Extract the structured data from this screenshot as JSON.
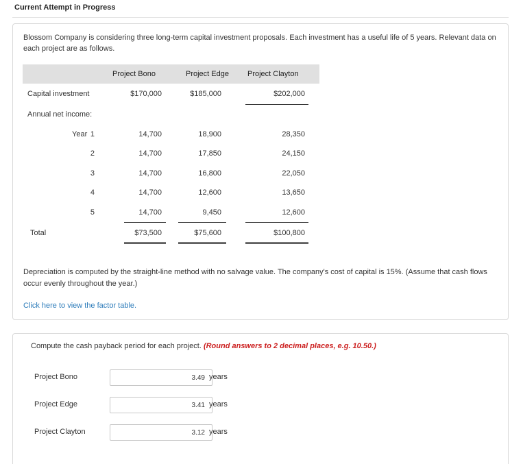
{
  "header": {
    "title": "Current Attempt in Progress"
  },
  "intro": "Blossom Company is considering three long-term capital investment proposals. Each investment has a useful life of 5 years. Relevant data on each project are as follows.",
  "table": {
    "columns": [
      "Project Bono",
      "Project Edge",
      "Project Clayton"
    ],
    "capital": {
      "label": "Capital investment",
      "values": [
        "$170,000",
        "$185,000",
        "$202,000"
      ]
    },
    "annual_label": "Annual net income:",
    "year_prefix": "Year",
    "years": [
      {
        "year": "1",
        "values": [
          "14,700",
          "18,900",
          "28,350"
        ]
      },
      {
        "year": "2",
        "values": [
          "14,700",
          "17,850",
          "24,150"
        ]
      },
      {
        "year": "3",
        "values": [
          "14,700",
          "16,800",
          "22,050"
        ]
      },
      {
        "year": "4",
        "values": [
          "14,700",
          "12,600",
          "13,650"
        ]
      },
      {
        "year": "5",
        "values": [
          "14,700",
          "9,450",
          "12,600"
        ]
      }
    ],
    "total": {
      "label": "Total",
      "values": [
        "$73,500",
        "$75,600",
        "$100,800"
      ]
    }
  },
  "depreciation_text": "Depreciation is computed by the straight-line method with no salvage value. The company's cost of capital is 15%. (Assume that cash flows occur evenly throughout the year.)",
  "factor_link": "Click here to view the factor table.",
  "question": {
    "text": "Compute the cash payback period for each project.",
    "note": "(Round answers to 2 decimal places, e.g. 10.50.)"
  },
  "answers": [
    {
      "label": "Project Bono",
      "value": "3.49",
      "unit": "years"
    },
    {
      "label": "Project Edge",
      "value": "3.41",
      "unit": "years"
    },
    {
      "label": "Project Clayton",
      "value": "3.12",
      "unit": "years"
    }
  ]
}
